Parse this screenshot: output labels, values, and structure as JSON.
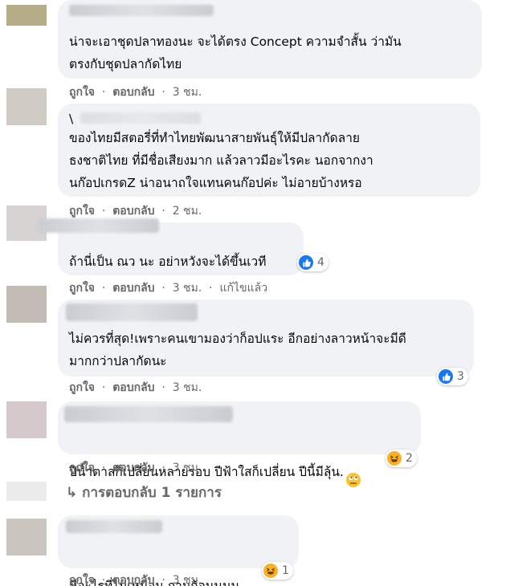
{
  "actions": {
    "like": "ถูกใจ",
    "reply": "ตอบกลับ",
    "separator": "·"
  },
  "comments": [
    {
      "text": "น่าจะเอาชุดปลาทองนะ จะได้ตรง Concept ความจำสั้น ว่ามัน\nตรงกับชุดปลากัดไทย",
      "time": "3 ชม."
    },
    {
      "text": "ของไทยมีสตอรี่ที่ทำไทยพัฒนาสายพันธุ์ให้มีปลากัดลาย\nธงชาติไทย ที่มีชื่อเสียงมาก แล้วลาวมีอะไรคะ นอกจากงา\nนก๊อปเกรดZ น่าอนาถใจแทนคนก๊อปค่ะ ไม่อายบ้างหรอ",
      "time": "2 ชม.",
      "name_partial": "\\"
    },
    {
      "text": "ถ้านี่เป็น ณว นะ อย่าหวังจะได้ขึ้นเวที",
      "time": "3 ชม.",
      "edited": "แก้ไขแล้ว",
      "reaction_count": "4"
    },
    {
      "text": "ไม่ควรที่สุด!เพราะคนเขามองว่าก็อปแระ อีกอย่างลาวหน้าจะมีดี\nมากกว่าปลากัดนะ",
      "time": "3 ชม.",
      "reaction_count": "3"
    },
    {
      "text": "ปีน้ำตาลก็เปลี่ยนหลายรอบ ปีฟ้าใสก็เปลี่ยน ปีนี้มีลุ้น.",
      "time": "3 ชม.",
      "reaction_count": "2",
      "inline_emoji": "rolling-eyes-emoji"
    },
    {
      "text": "มีอะไรที่ไม่เหมือน ถามก้อนนนน",
      "time": "3 ชม.",
      "reaction_count": "1",
      "inline_emoji": "smirk-emoji"
    }
  ],
  "replies_link": "↳ การตอบกลับ 1 รายการ",
  "colors": {
    "bubble": "#f0f2f5",
    "meta_text": "#65676b",
    "like_blue": "#1877f2",
    "haha_yellow": "#f7b125"
  }
}
